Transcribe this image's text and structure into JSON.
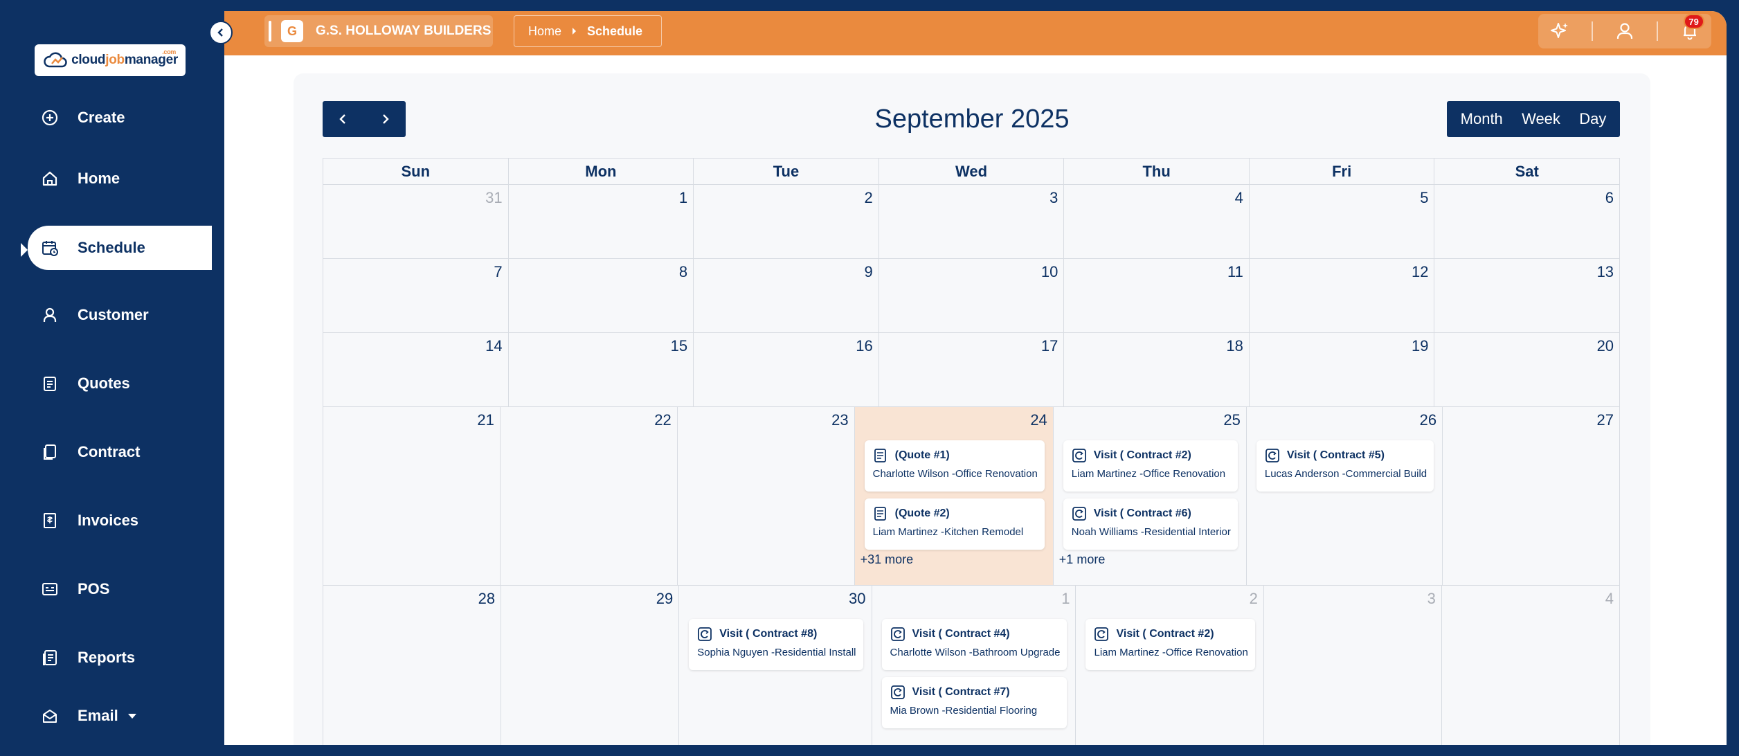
{
  "brand": {
    "logo_prefix": "cloud",
    "logo_accent": "job",
    "logo_suffix": "manager",
    "logo_tld": ".com"
  },
  "sidebar": {
    "items": [
      {
        "label": "Create",
        "icon": "plus-circle-icon"
      },
      {
        "label": "Home",
        "icon": "home-icon"
      },
      {
        "label": "Schedule",
        "icon": "calendar-clock-icon",
        "active": true
      },
      {
        "label": "Customer",
        "icon": "user-icon"
      },
      {
        "label": "Quotes",
        "icon": "clipboard-icon"
      },
      {
        "label": "Contract",
        "icon": "document-copy-icon"
      },
      {
        "label": "Invoices",
        "icon": "invoice-icon"
      },
      {
        "label": "POS",
        "icon": "pos-icon"
      },
      {
        "label": "Reports",
        "icon": "report-icon"
      },
      {
        "label": "Email",
        "icon": "mail-icon",
        "has_dropdown": true
      }
    ]
  },
  "header": {
    "company_initial": "G",
    "company_name": "G.S. HOLLOWAY BUILDERS",
    "breadcrumb": {
      "home": "Home",
      "current": "Schedule"
    },
    "notification_count": "79"
  },
  "calendar": {
    "title": "September 2025",
    "views": [
      "Month",
      "Week",
      "Day"
    ],
    "weekdays": [
      "Sun",
      "Mon",
      "Tue",
      "Wed",
      "Thu",
      "Fri",
      "Sat"
    ],
    "weeks": [
      {
        "days": [
          {
            "day": "31",
            "off": true
          },
          {
            "day": "1"
          },
          {
            "day": "2"
          },
          {
            "day": "3"
          },
          {
            "day": "4"
          },
          {
            "day": "5"
          },
          {
            "day": "6"
          }
        ]
      },
      {
        "days": [
          {
            "day": "7"
          },
          {
            "day": "8"
          },
          {
            "day": "9"
          },
          {
            "day": "10"
          },
          {
            "day": "11"
          },
          {
            "day": "12"
          },
          {
            "day": "13"
          }
        ]
      },
      {
        "days": [
          {
            "day": "14"
          },
          {
            "day": "15"
          },
          {
            "day": "16"
          },
          {
            "day": "17"
          },
          {
            "day": "18"
          },
          {
            "day": "19"
          },
          {
            "day": "20"
          }
        ]
      },
      {
        "days": [
          {
            "day": "21"
          },
          {
            "day": "22"
          },
          {
            "day": "23"
          },
          {
            "day": "24",
            "today": true,
            "events": [
              {
                "kind": "quote",
                "title": "(Quote #1)",
                "subtitle": "Charlotte Wilson -Office Renovation"
              },
              {
                "kind": "quote",
                "title": "(Quote #2)",
                "subtitle": "Liam Martinez -Kitchen Remodel"
              }
            ],
            "more": "+31 more"
          },
          {
            "day": "25",
            "events": [
              {
                "kind": "visit",
                "title": "Visit ( Contract #2)",
                "subtitle": "Liam Martinez -Office Renovation"
              },
              {
                "kind": "visit",
                "title": "Visit ( Contract #6)",
                "subtitle": "Noah Williams -Residential Interior"
              }
            ],
            "more": "+1 more"
          },
          {
            "day": "26",
            "events": [
              {
                "kind": "visit",
                "title": "Visit ( Contract #5)",
                "subtitle": "Lucas Anderson -Commercial Build"
              }
            ]
          },
          {
            "day": "27"
          }
        ]
      },
      {
        "days": [
          {
            "day": "28"
          },
          {
            "day": "29"
          },
          {
            "day": "30",
            "events": [
              {
                "kind": "visit",
                "title": "Visit ( Contract #8)",
                "subtitle": "Sophia Nguyen -Residential Install"
              }
            ]
          },
          {
            "day": "1",
            "off": true,
            "events": [
              {
                "kind": "visit",
                "title": "Visit ( Contract #4)",
                "subtitle": "Charlotte Wilson -Bathroom Upgrade"
              },
              {
                "kind": "visit",
                "title": "Visit ( Contract #7)",
                "subtitle": "Mia Brown -Residential Flooring"
              }
            ]
          },
          {
            "day": "2",
            "off": true,
            "events": [
              {
                "kind": "visit",
                "title": "Visit ( Contract #2)",
                "subtitle": "Liam Martinez -Office Renovation"
              }
            ]
          },
          {
            "day": "3",
            "off": true
          },
          {
            "day": "4",
            "off": true
          }
        ]
      }
    ]
  },
  "colors": {
    "navy": "#0d3163",
    "orange": "#ea8a3e",
    "today": "#f9e4d4",
    "badge": "#e01919"
  }
}
